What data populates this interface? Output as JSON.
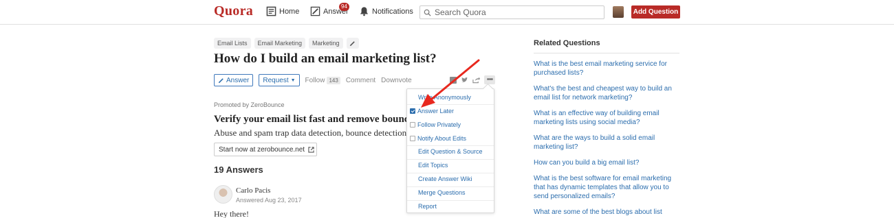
{
  "header": {
    "logo": "Quora",
    "nav": {
      "home": "Home",
      "answer": "Answer",
      "answer_badge": "94",
      "notifications": "Notifications"
    },
    "search_placeholder": "Search Quora",
    "add_question": "Add Question"
  },
  "question": {
    "topics": [
      "Email Lists",
      "Email Marketing",
      "Marketing"
    ],
    "title": "How do I build an email marketing list?",
    "actions": {
      "answer": "Answer",
      "request": "Request",
      "follow": "Follow",
      "follow_count": "143",
      "comment": "Comment",
      "downvote": "Downvote"
    }
  },
  "promoted": {
    "by": "Promoted by ZeroBounce",
    "title": "Verify your email list fast and remove bounces",
    "description": "Abuse and spam trap data detection, bounce detection and more.",
    "cta": "Start now at zerobounce.net"
  },
  "answers": {
    "count_label": "19 Answers",
    "first": {
      "author": "Carlo Pacis",
      "date": "Answered Aug 23, 2017",
      "text": "Hey there!"
    }
  },
  "menu": {
    "items": [
      {
        "label": "Write Anonymously",
        "checkbox": false
      },
      {
        "label": "Answer Later",
        "checkbox": true,
        "checked": true
      },
      {
        "label": "Follow Privately",
        "checkbox": true,
        "checked": false
      },
      {
        "label": "Notify About Edits",
        "checkbox": true,
        "checked": false
      },
      {
        "label": "Edit Question & Source",
        "checkbox": false
      },
      {
        "label": "Edit Topics",
        "checkbox": false
      },
      {
        "label": "Create Answer Wiki",
        "checkbox": false
      },
      {
        "label": "Merge Questions",
        "checkbox": false
      },
      {
        "label": "Report",
        "checkbox": false
      }
    ]
  },
  "related": {
    "title": "Related Questions",
    "items": [
      "What is the best email marketing service for purchased lists?",
      "What's the best and cheapest way to build an email list for network marketing?",
      "What is an effective way of building email marketing lists using social media?",
      "What are the ways to build a solid email marketing list?",
      "How can you build a big email list?",
      "What is the best software for email marketing that has dynamic templates that allow you to send personalized emails?",
      "What are some of the best blogs about list"
    ]
  },
  "colors": {
    "brand": "#b92b27",
    "link": "#2b6dad",
    "arrow": "#e8281e"
  }
}
